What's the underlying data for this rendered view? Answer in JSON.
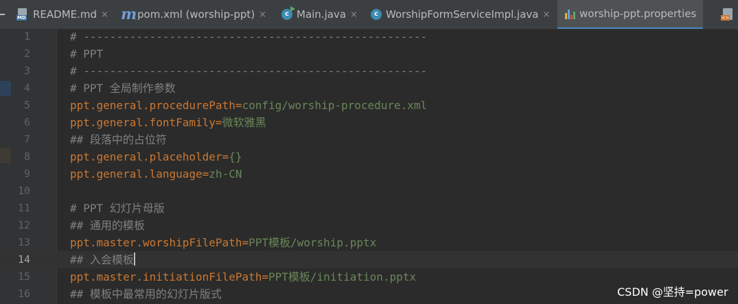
{
  "colors": {
    "background": "#2b2b2b",
    "tab_bar": "#3c3f41",
    "active_tab": "#4e5254",
    "active_tab_underline": "#4a88c7",
    "comment": "#808080",
    "key": "#cc7832",
    "value": "#6a8759",
    "line_number": "#606366"
  },
  "tabs": [
    {
      "label": "README.md",
      "icon": "markdown-file-icon",
      "closable": true,
      "active": false
    },
    {
      "label": "pom.xml (worship-ppt)",
      "icon": "maven-m-icon",
      "closable": true,
      "active": false
    },
    {
      "label": "Main.java",
      "icon": "java-class-run-icon",
      "closable": true,
      "active": false
    },
    {
      "label": "WorshipFormServiceImpl.java",
      "icon": "java-class-icon",
      "closable": true,
      "active": false
    },
    {
      "label": "worship-ppt.properties",
      "icon": "properties-file-icon",
      "closable": false,
      "active": true
    }
  ],
  "tab_close_glyph": "×",
  "current_line": 14,
  "lines": [
    {
      "n": "1",
      "type": "comment",
      "text": "# ----------------------------------------------------"
    },
    {
      "n": "2",
      "type": "comment",
      "text": "# PPT"
    },
    {
      "n": "3",
      "type": "comment",
      "text": "# ----------------------------------------------------"
    },
    {
      "n": "4",
      "type": "comment",
      "text": "# PPT 全局制作参数"
    },
    {
      "n": "5",
      "type": "prop",
      "key": "ppt.general.procedurePath",
      "eq": "=",
      "value": "config/worship-procedure.xml"
    },
    {
      "n": "6",
      "type": "prop",
      "key": "ppt.general.fontFamily",
      "eq": "=",
      "value": "微软雅黑"
    },
    {
      "n": "7",
      "type": "comment",
      "text": "## 段落中的占位符"
    },
    {
      "n": "8",
      "type": "prop",
      "key": "ppt.general.placeholder",
      "eq": "=",
      "value": "{}"
    },
    {
      "n": "9",
      "type": "prop",
      "key": "ppt.general.language",
      "eq": "=",
      "value": "zh-CN"
    },
    {
      "n": "10",
      "type": "empty",
      "text": ""
    },
    {
      "n": "11",
      "type": "comment",
      "text": "# PPT 幻灯片母版"
    },
    {
      "n": "12",
      "type": "comment",
      "text": "## 通用的模板"
    },
    {
      "n": "13",
      "type": "prop",
      "key": "ppt.master.worshipFilePath",
      "eq": "=",
      "value": "PPT模板/worship.pptx"
    },
    {
      "n": "14",
      "type": "comment",
      "text": "## 入会模板"
    },
    {
      "n": "15",
      "type": "prop",
      "key": "ppt.master.initiationFilePath",
      "eq": "=",
      "value": "PPT模板/initiation.pptx"
    },
    {
      "n": "16",
      "type": "comment",
      "text": "## 模板中最常用的幻灯片版式"
    }
  ],
  "watermark": "CSDN @坚持=power"
}
